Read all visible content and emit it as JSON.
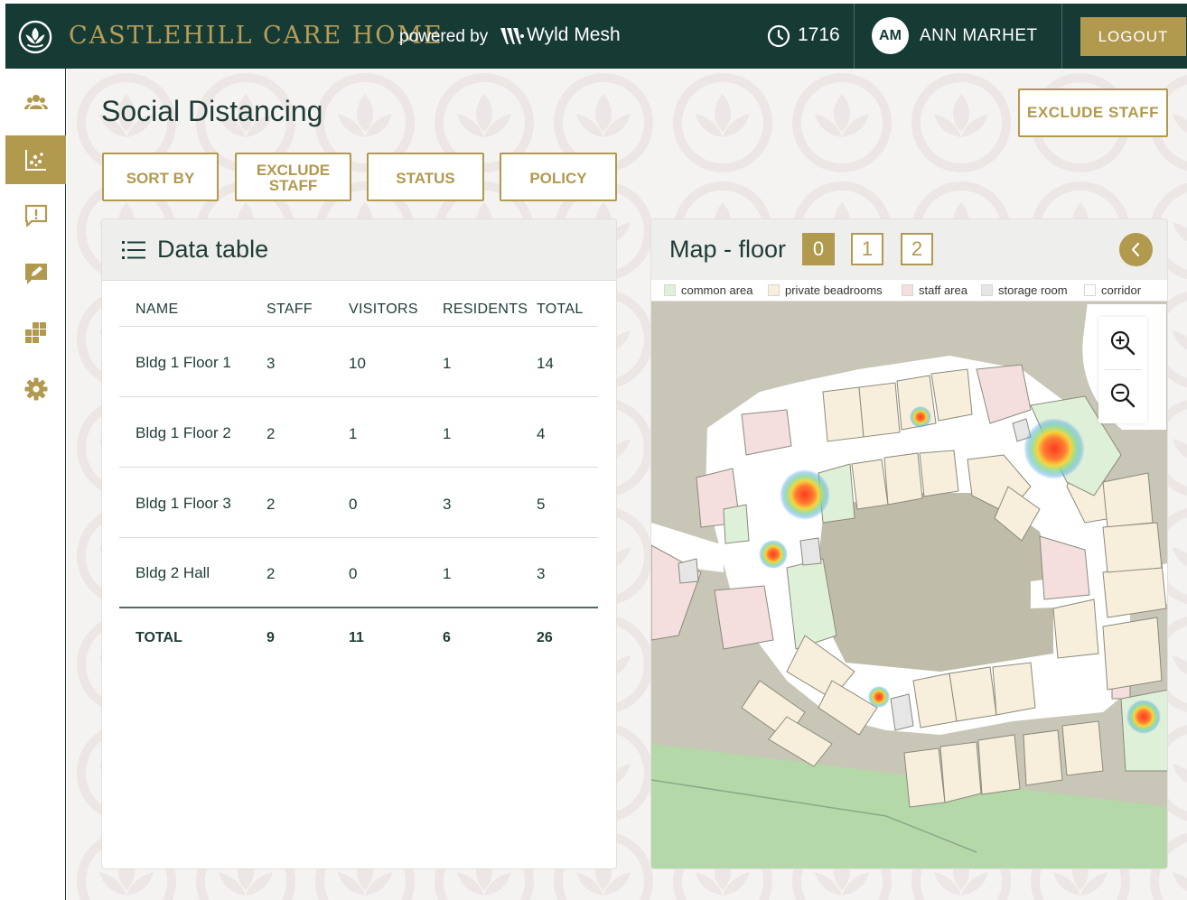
{
  "header": {
    "brand": "CASTLEHILL CARE HOME",
    "powered_by": "powered by",
    "partner": "Wyld Mesh",
    "clock_count": "1716",
    "user_initials": "AM",
    "user_name": "ANN MARHET",
    "logout_label": "LOGOUT"
  },
  "sidebar": {
    "items": [
      {
        "icon": "people-icon",
        "active": false
      },
      {
        "icon": "scatter-chart-icon",
        "active": true
      },
      {
        "icon": "alert-message-icon",
        "active": false
      },
      {
        "icon": "edit-note-icon",
        "active": false
      },
      {
        "icon": "dashboard-grid-icon",
        "active": false
      },
      {
        "icon": "gear-icon",
        "active": false
      }
    ]
  },
  "page": {
    "title": "Social Distancing",
    "exclude_staff_label": "EXCLUDE STAFF",
    "filters": {
      "sort_by": "SORT BY",
      "exclude_staff_line1": "EXCLUDE",
      "exclude_staff_line2": "STAFF",
      "status": "STATUS",
      "policy": "POLICY"
    }
  },
  "table": {
    "title": "Data table",
    "columns": [
      "NAME",
      "STAFF",
      "VISITORS",
      "RESIDENTS",
      "TOTAL"
    ],
    "rows": [
      [
        "Bldg 1 Floor 1",
        "3",
        "10",
        "1",
        "14"
      ],
      [
        "Bldg 1 Floor 2",
        "2",
        "1",
        "1",
        "4"
      ],
      [
        "Bldg 1 Floor 3",
        "2",
        "0",
        "3",
        "5"
      ],
      [
        "Bldg 2 Hall",
        "2",
        "0",
        "1",
        "3"
      ]
    ],
    "total": [
      "TOTAL",
      "9",
      "11",
      "6",
      "26"
    ]
  },
  "map": {
    "title": "Map - floor",
    "floors": [
      "0",
      "1",
      "2"
    ],
    "active_floor": "0",
    "legend": [
      {
        "label": "common area",
        "color": "#dff0d8"
      },
      {
        "label": "private beadrooms",
        "color": "#f7eedb"
      },
      {
        "label": "staff area",
        "color": "#f5dede"
      },
      {
        "label": "storage room",
        "color": "#e6e6e6"
      },
      {
        "label": "corridor",
        "color": "#ffffff"
      }
    ]
  },
  "colors": {
    "brand_dark": "#163a34",
    "gold": "#b1994e",
    "text": "#1e3c36"
  }
}
